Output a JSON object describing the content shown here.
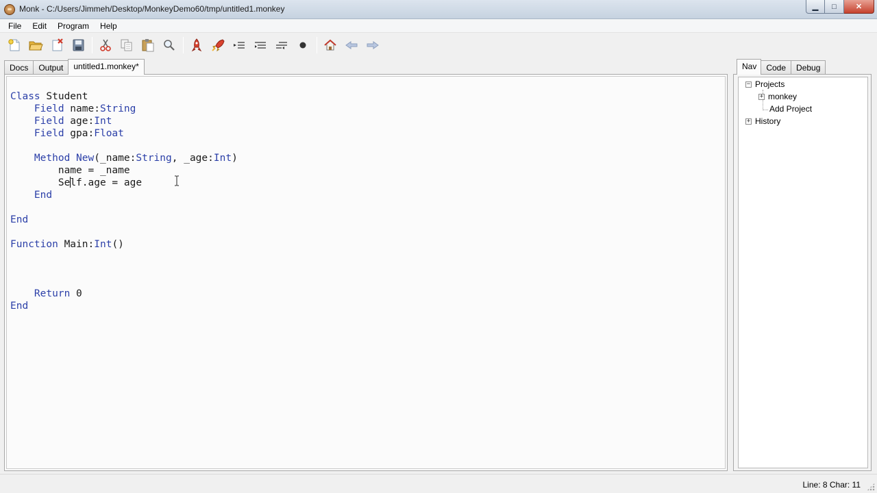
{
  "window": {
    "title": "Monk - C:/Users/Jimmeh/Desktop/MonkeyDemo60/tmp/untitled1.monkey",
    "controls": {
      "minimize": "▁",
      "maximize": "□",
      "close": "✕"
    }
  },
  "menu": [
    "File",
    "Edit",
    "Program",
    "Help"
  ],
  "toolbar": {
    "icons": [
      "new-file-icon",
      "open-folder-icon",
      "close-file-icon",
      "save-icon",
      "cut-icon",
      "copy-icon",
      "paste-icon",
      "find-icon",
      "build-icon",
      "build-run-icon",
      "step-icon",
      "step-in-icon",
      "step-out-icon",
      "breakpoint-icon",
      "home-icon",
      "back-icon",
      "forward-icon"
    ]
  },
  "left_tabs": [
    {
      "label": "Docs",
      "active": false
    },
    {
      "label": "Output",
      "active": false
    },
    {
      "label": "untitled1.monkey*",
      "active": true
    }
  ],
  "right_tabs": [
    {
      "label": "Nav",
      "active": true
    },
    {
      "label": "Code",
      "active": false
    },
    {
      "label": "Debug",
      "active": false
    }
  ],
  "editor": {
    "keyword_color": "#2b3fa8",
    "lines": [
      "Class Student",
      "    Field name:String",
      "    Field age:Int",
      "    Field gpa:Float",
      "",
      "    Method New(_name:String, _age:Int)",
      "        name = _name",
      "        Self.age = age",
      "    End",
      "",
      "End",
      "",
      "Function Main:Int()",
      "",
      "",
      "",
      "    Return 0",
      "End"
    ],
    "caret": {
      "line": 8,
      "char": 11
    }
  },
  "nav_tree": {
    "projects": "Projects",
    "monkey": "monkey",
    "add_project": "Add Project",
    "history": "History",
    "expanded_glyph": "−",
    "collapsed_glyph": "+"
  },
  "status": {
    "text": "Line: 8 Char: 11"
  }
}
